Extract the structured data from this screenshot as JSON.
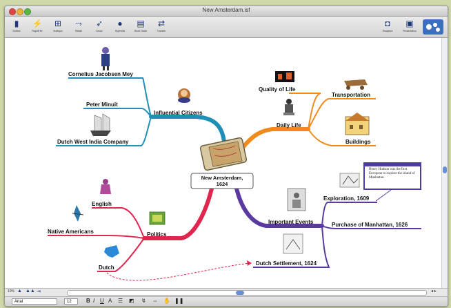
{
  "window": {
    "title": "New Amsterdam.isf"
  },
  "toolbar": {
    "left": [
      {
        "label": "Outline",
        "icon": "outline-icon"
      },
      {
        "label": "RapidFire",
        "icon": "rapidfire-icon"
      },
      {
        "label": "Subtopic",
        "icon": "subtopic-icon"
      },
      {
        "label": "Relate",
        "icon": "relate-icon"
      },
      {
        "label": "Arrow",
        "icon": "arrow-icon"
      },
      {
        "label": "Hyperlink",
        "icon": "hyperlink-icon"
      },
      {
        "label": "Word Guide",
        "icon": "word-guide-icon"
      },
      {
        "label": "Transfer",
        "icon": "transfer-icon"
      }
    ],
    "right": [
      {
        "label": "Snapshot",
        "icon": "snapshot-icon"
      },
      {
        "label": "Presentation",
        "icon": "presentation-icon"
      }
    ]
  },
  "map": {
    "central": {
      "line1": "New Amsterdam,",
      "line2": "1624"
    },
    "influential_citizens": {
      "label": "Influential Citizens",
      "children": [
        "Cornelius Jacobsen Mey",
        "Peter Minuit",
        "Dutch West India Company"
      ]
    },
    "daily_life": {
      "label": "Daily Life",
      "children": [
        "Quality of Life",
        "Transportation",
        "Buildings"
      ]
    },
    "politics": {
      "label": "Politics",
      "children": [
        "English",
        "Native Americans",
        "Dutch"
      ]
    },
    "important_events": {
      "label": "Important Events",
      "children": [
        "Exploration, 1609",
        "Purchase of Manhattan, 1626",
        "Dutch Settlement, 1624"
      ]
    },
    "note": {
      "text": "Henry Hudson was the first European to explore the island of Manhattan."
    }
  },
  "statusbar": {
    "zoom": "10%"
  },
  "format": {
    "font": "Arial",
    "size": "12",
    "bold": "B",
    "italic": "I",
    "underline": "U"
  },
  "colors": {
    "influential": "#1f8fb5",
    "daily_life": "#f08a1c",
    "politics": "#e0264e",
    "events": "#5a3aa0",
    "relation": "#e0264e"
  }
}
